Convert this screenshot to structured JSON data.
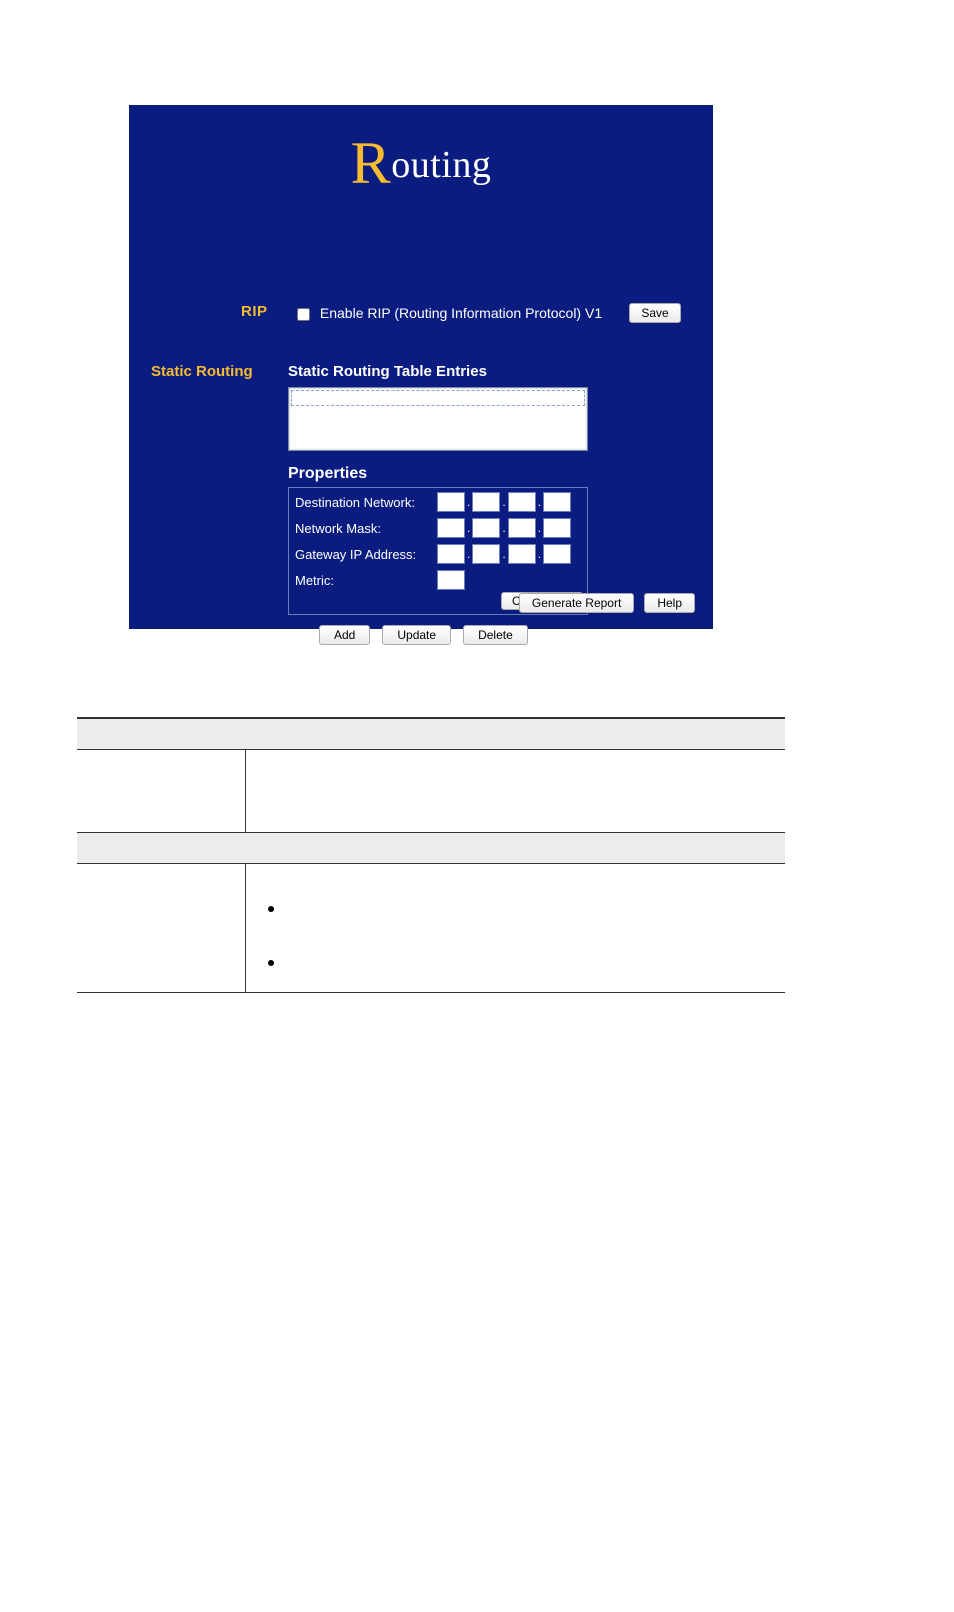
{
  "router": {
    "title_letter": "R",
    "title_rest": "outing",
    "rip": {
      "label": "RIP",
      "checkbox_label": "Enable RIP (Routing Information Protocol) V1",
      "checked": false,
      "save_label": "Save"
    },
    "static": {
      "section_label": "Static Routing",
      "table_heading": "Static Routing Table Entries",
      "properties_heading": "Properties",
      "fields": {
        "destination_label": "Destination Network:",
        "mask_label": "Network Mask:",
        "gateway_label": "Gateway IP Address:",
        "metric_label": "Metric:",
        "destination": [
          "",
          "",
          "",
          ""
        ],
        "mask": [
          "",
          "",
          "",
          ""
        ],
        "gateway": [
          "",
          "",
          "",
          ""
        ],
        "metric": ""
      },
      "clear_form_label": "Clear Form",
      "add_label": "Add",
      "update_label": "Update",
      "delete_label": "Delete"
    },
    "footer": {
      "generate_report_label": "Generate Report",
      "help_label": "Help"
    }
  }
}
